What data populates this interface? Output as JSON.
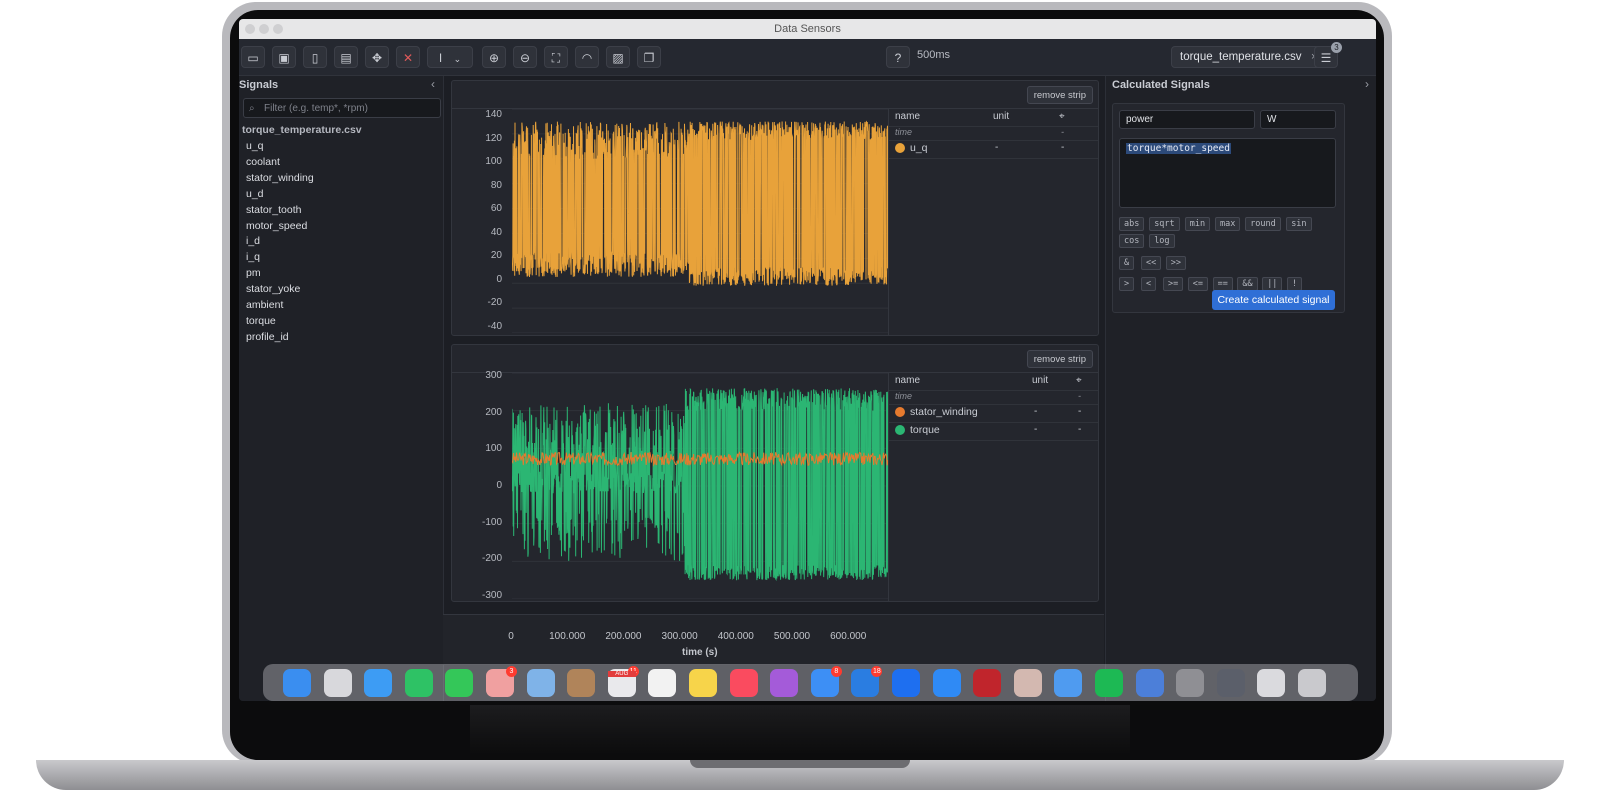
{
  "window": {
    "title": "Data Sensors"
  },
  "toolbar": {
    "interval": "500ms",
    "file_tab": "torque_temperature.csv",
    "file_close": "×",
    "panel_badge": "3"
  },
  "signals_panel": {
    "title": "Signals",
    "filter_placeholder": "Filter (e.g. temp*, *rpm)",
    "file": "torque_temperature.csv",
    "signals": [
      "u_q",
      "coolant",
      "stator_winding",
      "u_d",
      "stator_tooth",
      "motor_speed",
      "i_d",
      "i_q",
      "pm",
      "stator_yoke",
      "ambient",
      "torque",
      "profile_id"
    ]
  },
  "strips": [
    {
      "remove_label": "remove strip",
      "legend_headers": [
        "name",
        "unit"
      ],
      "time_row": {
        "label": "time",
        "value": "-"
      },
      "rows": [
        {
          "name": "u_q",
          "unit": "-",
          "value": "-",
          "color": "#e8a23a"
        }
      ],
      "yticks": [
        "140",
        "120",
        "100",
        "80",
        "60",
        "40",
        "20",
        "0",
        "-20",
        "-40"
      ]
    },
    {
      "remove_label": "remove strip",
      "legend_headers": [
        "name",
        "unit"
      ],
      "time_row": {
        "label": "time",
        "value": "-"
      },
      "rows": [
        {
          "name": "stator_winding",
          "unit": "-",
          "value": "-",
          "color": "#e67a2e"
        },
        {
          "name": "torque",
          "unit": "-",
          "value": "-",
          "color": "#2bb673"
        }
      ],
      "yticks": [
        "300",
        "200",
        "100",
        "0",
        "-100",
        "-200",
        "-300"
      ]
    }
  ],
  "x_axis": {
    "ticks": [
      "0",
      "100.000",
      "200.000",
      "300.000",
      "400.000",
      "500.000",
      "600.000"
    ],
    "label": "time (s)"
  },
  "calc_panel": {
    "title": "Calculated Signals",
    "name_value": "power",
    "unit_value": "W",
    "expression": "torque*motor_speed",
    "functions_row1": [
      "abs",
      "sqrt",
      "min",
      "max",
      "round",
      "sin"
    ],
    "functions_row2": [
      "cos",
      "log"
    ],
    "operators_row1": [
      "&",
      "<<",
      ">>"
    ],
    "operators_row2": [
      ">",
      "<",
      ">=",
      "<=",
      "==",
      "&&",
      "||",
      "!"
    ],
    "create_label": "Create calculated signal"
  },
  "colors": {
    "accent": "#2f6fd6",
    "u_q": "#e8a23a",
    "stator_winding": "#e67a2e",
    "torque": "#2bb673"
  },
  "dock": {
    "badges": [
      "3",
      "11",
      "8",
      "18"
    ],
    "calendar_month": "AUG"
  },
  "chart_data": [
    {
      "type": "line",
      "series": [
        {
          "name": "u_q"
        }
      ],
      "xlim": [
        0,
        665000
      ],
      "ylim": [
        -40,
        140
      ],
      "description_values": {
        "envelope_early": [
          5,
          130
        ],
        "envelope_dense": [
          -5,
          130
        ]
      }
    },
    {
      "type": "line",
      "series": [
        {
          "name": "stator_winding"
        },
        {
          "name": "torque"
        }
      ],
      "xlim": [
        0,
        665000
      ],
      "ylim": [
        -300,
        300
      ],
      "xlabel": "time (s)"
    }
  ]
}
